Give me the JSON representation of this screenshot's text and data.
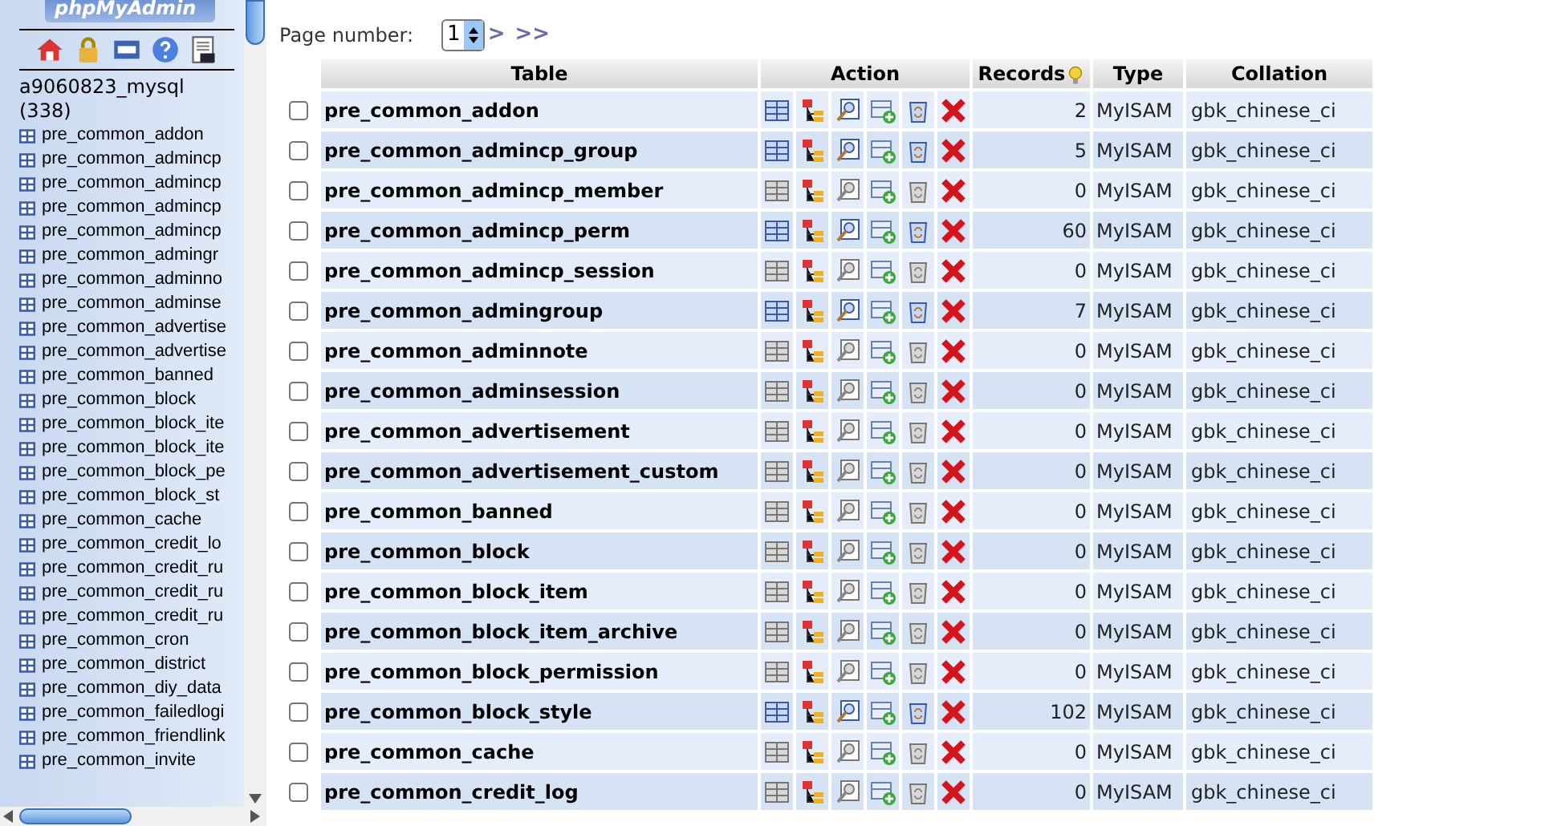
{
  "sidebar": {
    "logo": "phpMyAdmin",
    "database": "a9060823_mysql",
    "table_count": "(338)",
    "tables": [
      "pre_common_addon",
      "pre_common_admincp",
      "pre_common_admincp",
      "pre_common_admincp",
      "pre_common_admincp",
      "pre_common_admingr",
      "pre_common_adminno",
      "pre_common_adminse",
      "pre_common_advertise",
      "pre_common_advertise",
      "pre_common_banned",
      "pre_common_block",
      "pre_common_block_ite",
      "pre_common_block_ite",
      "pre_common_block_pe",
      "pre_common_block_st",
      "pre_common_cache",
      "pre_common_credit_lo",
      "pre_common_credit_ru",
      "pre_common_credit_ru",
      "pre_common_credit_ru",
      "pre_common_cron",
      "pre_common_district",
      "pre_common_diy_data",
      "pre_common_failedlogi",
      "pre_common_friendlink",
      "pre_common_invite"
    ]
  },
  "pager": {
    "label": "Page number:",
    "value": "1",
    "next": ">",
    "last": ">>"
  },
  "table": {
    "columns": [
      "Table",
      "Action",
      "Records",
      "Type",
      "Collation"
    ],
    "rows": [
      {
        "name": "pre_common_addon",
        "records": "2",
        "type": "MyISAM",
        "collation": "gbk_chinese_ci",
        "checked": false,
        "has_data": true
      },
      {
        "name": "pre_common_admincp_group",
        "records": "5",
        "type": "MyISAM",
        "collation": "gbk_chinese_ci",
        "checked": false,
        "has_data": true
      },
      {
        "name": "pre_common_admincp_member",
        "records": "0",
        "type": "MyISAM",
        "collation": "gbk_chinese_ci",
        "checked": false,
        "has_data": false
      },
      {
        "name": "pre_common_admincp_perm",
        "records": "60",
        "type": "MyISAM",
        "collation": "gbk_chinese_ci",
        "checked": false,
        "has_data": true
      },
      {
        "name": "pre_common_admincp_session",
        "records": "0",
        "type": "MyISAM",
        "collation": "gbk_chinese_ci",
        "checked": false,
        "has_data": false
      },
      {
        "name": "pre_common_admingroup",
        "records": "7",
        "type": "MyISAM",
        "collation": "gbk_chinese_ci",
        "checked": false,
        "has_data": true
      },
      {
        "name": "pre_common_adminnote",
        "records": "0",
        "type": "MyISAM",
        "collation": "gbk_chinese_ci",
        "checked": false,
        "has_data": false
      },
      {
        "name": "pre_common_adminsession",
        "records": "0",
        "type": "MyISAM",
        "collation": "gbk_chinese_ci",
        "checked": false,
        "has_data": false
      },
      {
        "name": "pre_common_advertisement",
        "records": "0",
        "type": "MyISAM",
        "collation": "gbk_chinese_ci",
        "checked": false,
        "has_data": false
      },
      {
        "name": "pre_common_advertisement_custom",
        "records": "0",
        "type": "MyISAM",
        "collation": "gbk_chinese_ci",
        "checked": false,
        "has_data": false
      },
      {
        "name": "pre_common_banned",
        "records": "0",
        "type": "MyISAM",
        "collation": "gbk_chinese_ci",
        "checked": false,
        "has_data": false
      },
      {
        "name": "pre_common_block",
        "records": "0",
        "type": "MyISAM",
        "collation": "gbk_chinese_ci",
        "checked": false,
        "has_data": false
      },
      {
        "name": "pre_common_block_item",
        "records": "0",
        "type": "MyISAM",
        "collation": "gbk_chinese_ci",
        "checked": false,
        "has_data": false
      },
      {
        "name": "pre_common_block_item_archive",
        "records": "0",
        "type": "MyISAM",
        "collation": "gbk_chinese_ci",
        "checked": false,
        "has_data": false
      },
      {
        "name": "pre_common_block_permission",
        "records": "0",
        "type": "MyISAM",
        "collation": "gbk_chinese_ci",
        "checked": false,
        "has_data": false
      },
      {
        "name": "pre_common_block_style",
        "records": "102",
        "type": "MyISAM",
        "collation": "gbk_chinese_ci",
        "checked": false,
        "has_data": true
      },
      {
        "name": "pre_common_cache",
        "records": "0",
        "type": "MyISAM",
        "collation": "gbk_chinese_ci",
        "checked": false,
        "has_data": false
      },
      {
        "name": "pre_common_credit_log",
        "records": "0",
        "type": "MyISAM",
        "collation": "gbk_chinese_ci",
        "checked": false,
        "has_data": false
      }
    ]
  }
}
